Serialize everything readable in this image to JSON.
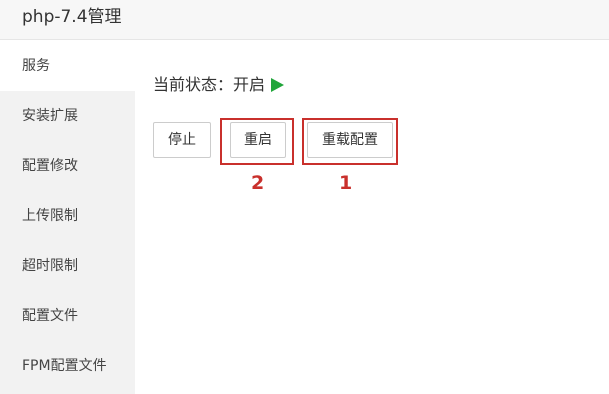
{
  "window": {
    "title": "php-7.4管理"
  },
  "sidebar": {
    "items": [
      {
        "label": "服务",
        "active": true
      },
      {
        "label": "安装扩展"
      },
      {
        "label": "配置修改"
      },
      {
        "label": "上传限制"
      },
      {
        "label": "超时限制"
      },
      {
        "label": "配置文件"
      },
      {
        "label": "FPM配置文件"
      }
    ]
  },
  "service": {
    "status_label": "当前状态：",
    "status_value": "开启",
    "buttons": {
      "stop": "停止",
      "restart": "重启",
      "reload": "重载配置"
    }
  },
  "annotations": {
    "restart_marker": "2",
    "reload_marker": "1"
  },
  "colors": {
    "status_running": "#20a53a",
    "annotation": "#c9302c",
    "sidebar_bg": "#f2f2f2"
  }
}
